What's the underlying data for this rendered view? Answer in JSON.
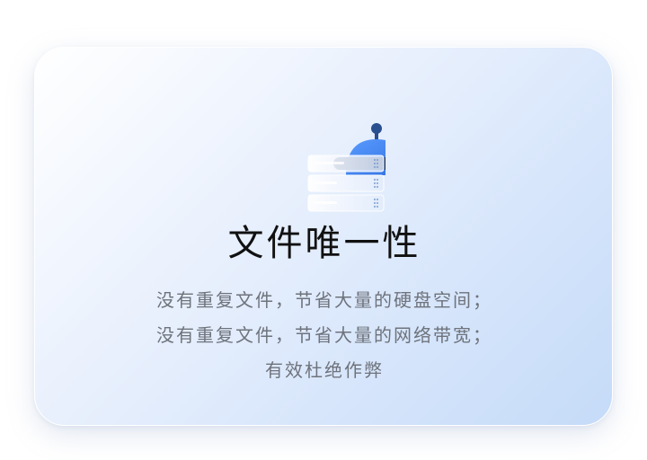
{
  "card": {
    "title": "文件唯一性",
    "lines": [
      "没有重复文件，节省大量的硬盘空间；",
      "没有重复文件，节省大量的网络带宽；",
      "有效杜绝作弊"
    ],
    "icon": "robot-server-icon"
  },
  "colors": {
    "robot_blue": "#3b82f0",
    "robot_dark": "#1f3a6b",
    "title_text": "#111111",
    "desc_text": "#6e737c"
  }
}
